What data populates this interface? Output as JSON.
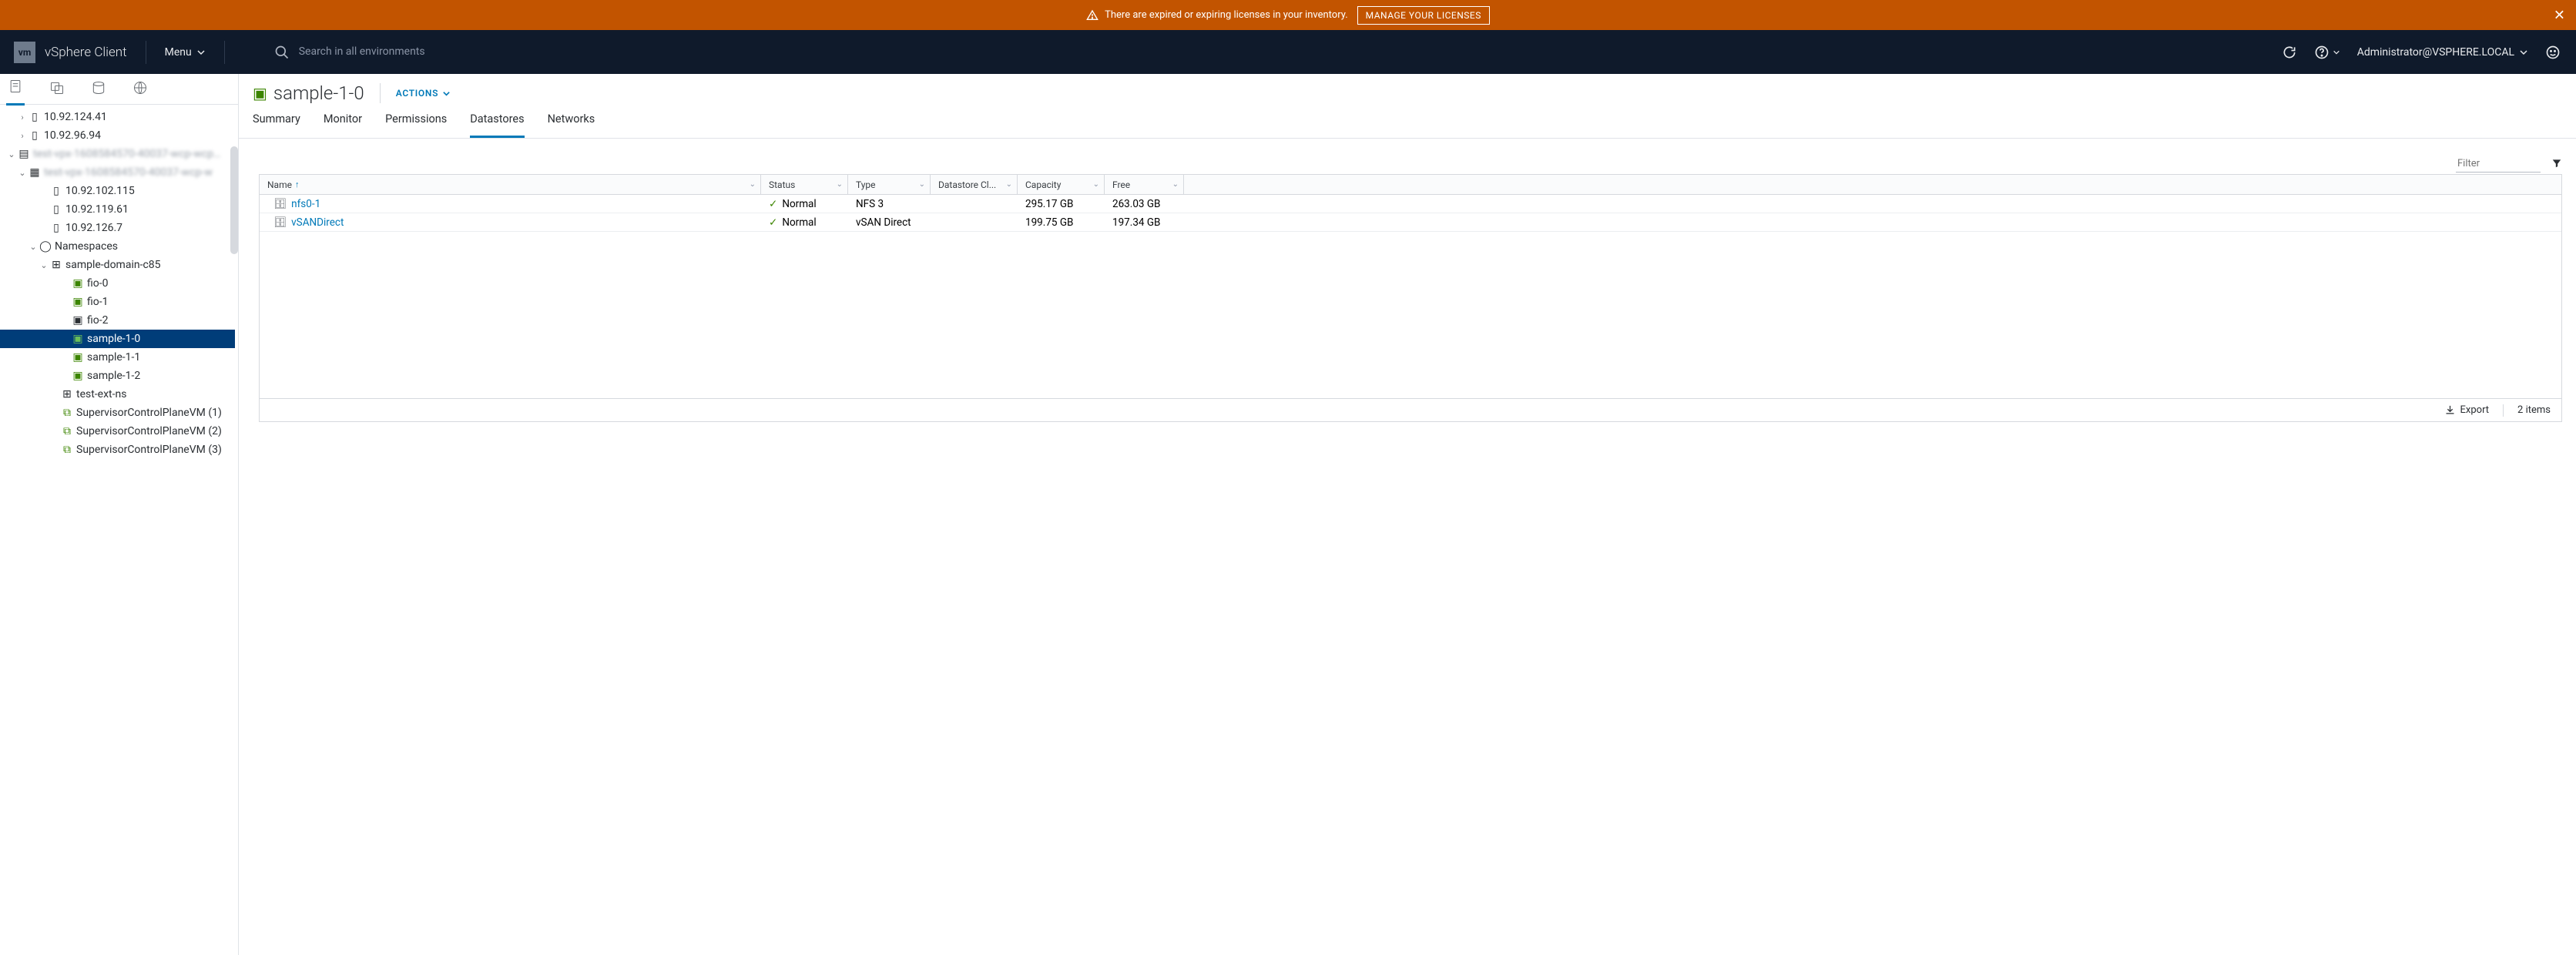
{
  "banner": {
    "message": "There are expired or expiring licenses in your inventory.",
    "button": "Manage Your Licenses"
  },
  "header": {
    "logo_text": "vm",
    "client_name": "vSphere Client",
    "menu_label": "Menu",
    "search_placeholder": "Search in all environments",
    "user": "Administrator@VSPHERE.LOCAL"
  },
  "tree": {
    "n0": "10.92.124.41",
    "n1": "10.92.96.94",
    "n2": "test-vpx-1608584570-40037-wcp-wcp…",
    "n3": "test-vpx-1608584570-40037-wcp-w",
    "n4": "10.92.102.115",
    "n5": "10.92.119.61",
    "n6": "10.92.126.7",
    "n7": "Namespaces",
    "n8": "sample-domain-c85",
    "n9": "fio-0",
    "n10": "fio-1",
    "n11": "fio-2",
    "n12": "sample-1-0",
    "n13": "sample-1-1",
    "n14": "sample-1-2",
    "n15": "test-ext-ns",
    "n16": "SupervisorControlPlaneVM (1)",
    "n17": "SupervisorControlPlaneVM (2)",
    "n18": "SupervisorControlPlaneVM (3)"
  },
  "page": {
    "title": "sample-1-0",
    "actions_label": "ACTIONS"
  },
  "tabs": {
    "summary": "Summary",
    "monitor": "Monitor",
    "permissions": "Permissions",
    "datastores": "Datastores",
    "networks": "Networks"
  },
  "grid": {
    "filter_placeholder": "Filter",
    "headers": {
      "name": "Name",
      "status": "Status",
      "type": "Type",
      "cluster": "Datastore Cl...",
      "capacity": "Capacity",
      "free": "Free"
    },
    "rows": [
      {
        "name": "nfs0-1",
        "status": "Normal",
        "type": "NFS 3",
        "cluster": "",
        "capacity": "295.17 GB",
        "free": "263.03 GB"
      },
      {
        "name": "vSANDirect",
        "status": "Normal",
        "type": "vSAN Direct",
        "cluster": "",
        "capacity": "199.75 GB",
        "free": "197.34 GB"
      }
    ],
    "export_label": "Export",
    "count_label": "2 items"
  }
}
